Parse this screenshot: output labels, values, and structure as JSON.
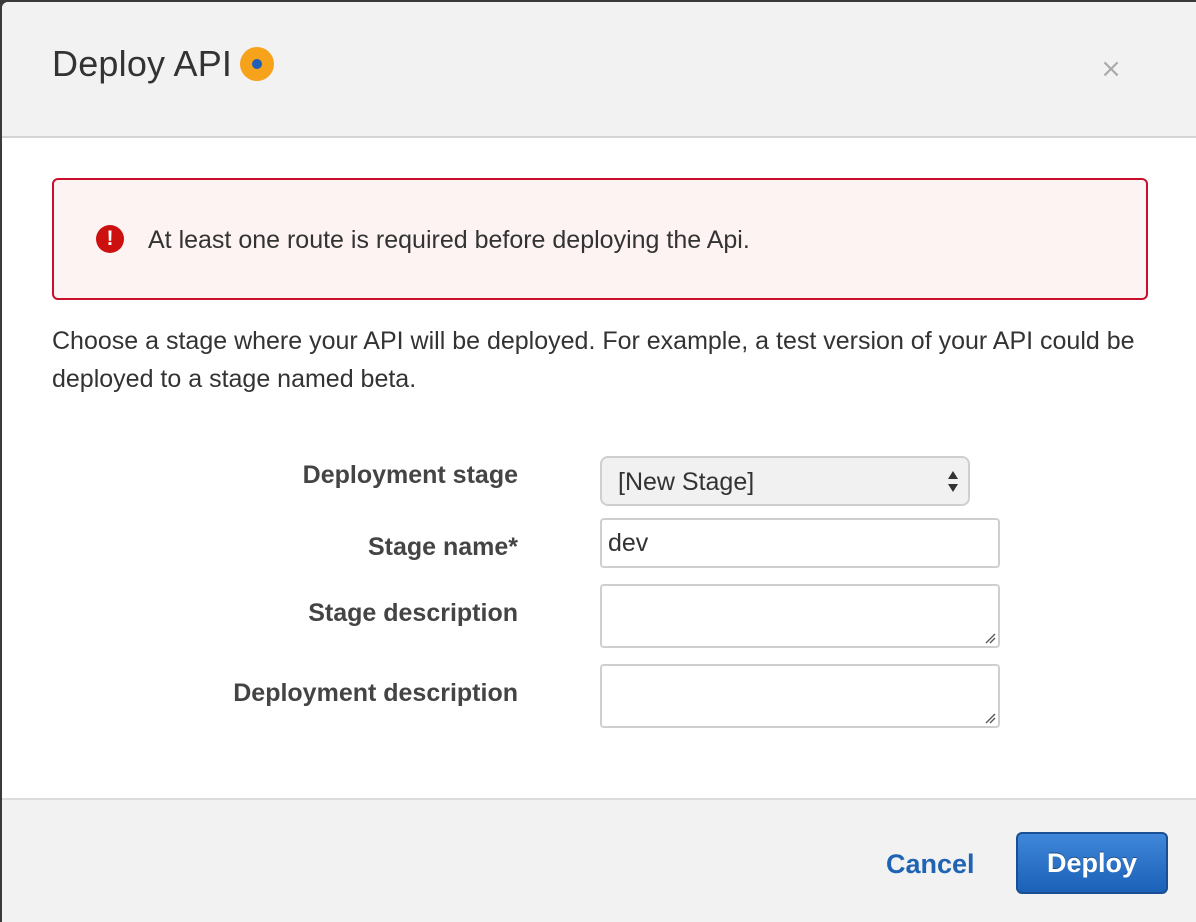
{
  "dialog": {
    "title": "Deploy API",
    "close_label": "×"
  },
  "alert": {
    "icon": "error-exclamation-icon",
    "icon_glyph": "!",
    "message": "At least one route is required before deploying the Api.",
    "border_color": "#c8102e",
    "background_color": "#fdf3f2"
  },
  "intro": {
    "text": "Choose a stage where your API will be deployed. For example, a test version of your API could be deployed to a stage named beta."
  },
  "form": {
    "deployment_stage": {
      "label": "Deployment stage",
      "selected": "[New Stage]"
    },
    "stage_name": {
      "label": "Stage name*",
      "value": "dev"
    },
    "stage_description": {
      "label": "Stage description",
      "value": ""
    },
    "deployment_description": {
      "label": "Deployment description",
      "value": ""
    }
  },
  "footer": {
    "cancel_label": "Cancel",
    "deploy_label": "Deploy",
    "link_color": "#1f63b3",
    "primary_color": "#1b61b8"
  }
}
